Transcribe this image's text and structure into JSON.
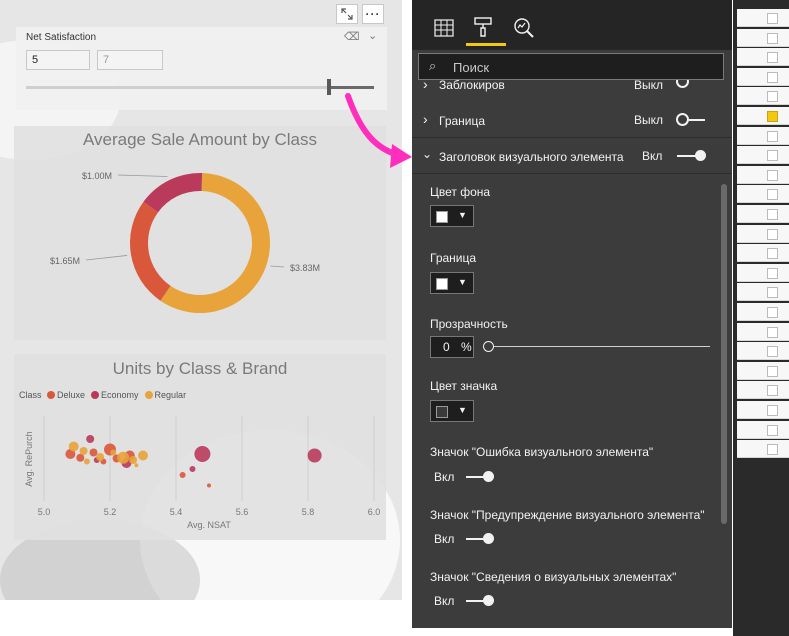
{
  "slicer": {
    "title": "Net Satisfaction",
    "from_value": "5",
    "to_value": "7",
    "range_fraction": 0.87
  },
  "visual_header": {
    "expand_icon": "focus-mode-icon",
    "more_label": "···"
  },
  "donut": {
    "title": "Average Sale Amount by Class",
    "colors": [
      "#e8a33a",
      "#d9583b",
      "#b93a5b"
    ],
    "chart_data": {
      "type": "pie",
      "title": "Average Sale Amount by Class",
      "values": [
        3.83,
        1.65,
        1.0
      ],
      "labels": [
        "$3.83M",
        "$1.65M",
        "$1.00M"
      ]
    }
  },
  "scatter": {
    "title": "Units by Class & Brand",
    "legend_title": "Class",
    "legend": [
      {
        "name": "Deluxe",
        "color": "#d9583b"
      },
      {
        "name": "Economy",
        "color": "#b93a5b"
      },
      {
        "name": "Regular",
        "color": "#e8a33a"
      }
    ],
    "xlabel": "Avg. NSAT",
    "ylabel": "Avg. RePurch",
    "x_ticks": [
      "5.0",
      "5.2",
      "5.4",
      "5.6",
      "5.8",
      "6.0"
    ],
    "chart_data": {
      "type": "scatter",
      "title": "Units by Class & Brand",
      "xlabel": "Avg. NSAT",
      "ylabel": "Avg. RePurch",
      "xlim": [
        5.0,
        6.0
      ],
      "series": [
        {
          "name": "Deluxe",
          "points": [
            [
              5.08,
              0.6
            ],
            [
              5.11,
              0.55
            ],
            [
              5.15,
              0.62
            ],
            [
              5.18,
              0.5
            ],
            [
              5.2,
              0.66
            ],
            [
              5.22,
              0.54
            ],
            [
              5.26,
              0.58
            ],
            [
              5.42,
              0.32
            ],
            [
              5.5,
              0.18
            ]
          ]
        },
        {
          "name": "Economy",
          "points": [
            [
              5.14,
              0.8
            ],
            [
              5.16,
              0.52
            ],
            [
              5.25,
              0.48
            ],
            [
              5.48,
              0.6
            ],
            [
              5.82,
              0.58
            ],
            [
              5.45,
              0.4
            ]
          ]
        },
        {
          "name": "Regular",
          "points": [
            [
              5.09,
              0.7
            ],
            [
              5.12,
              0.64
            ],
            [
              5.17,
              0.56
            ],
            [
              5.21,
              0.62
            ],
            [
              5.24,
              0.55
            ],
            [
              5.27,
              0.52
            ],
            [
              5.3,
              0.58
            ],
            [
              5.13,
              0.5
            ],
            [
              5.28,
              0.45
            ]
          ]
        }
      ]
    }
  },
  "pane": {
    "tabs": [
      "fields-icon",
      "format-paint-icon",
      "analytics-icon"
    ],
    "search_placeholder": "Поиск",
    "sections": [
      {
        "label": "Заблокиров",
        "value": "Выкл"
      },
      {
        "label": "Граница",
        "value": "Выкл"
      },
      {
        "label": "Заголовок визуального элемента",
        "value": "Вкл"
      }
    ],
    "bg_color_label": "Цвет фона",
    "border_label": "Граница",
    "transparency_label": "Прозрачность",
    "transparency_value": "0",
    "transparency_unit": "%",
    "icon_color_label": "Цвет значка",
    "toggles": [
      {
        "label": "Значок \"Ошибка визуального элемента\"",
        "value": "Вкл"
      },
      {
        "label": "Значок \"Предупреждение визуального элемента\"",
        "value": "Вкл"
      },
      {
        "label": "Значок \"Сведения о визуальных элементах\"",
        "value": "Вкл"
      }
    ],
    "swatch_colors": {
      "bg": "#ffffff",
      "border": "#ffffff",
      "icon": "#3a3a3a"
    }
  },
  "accent": "#ff2fbd"
}
